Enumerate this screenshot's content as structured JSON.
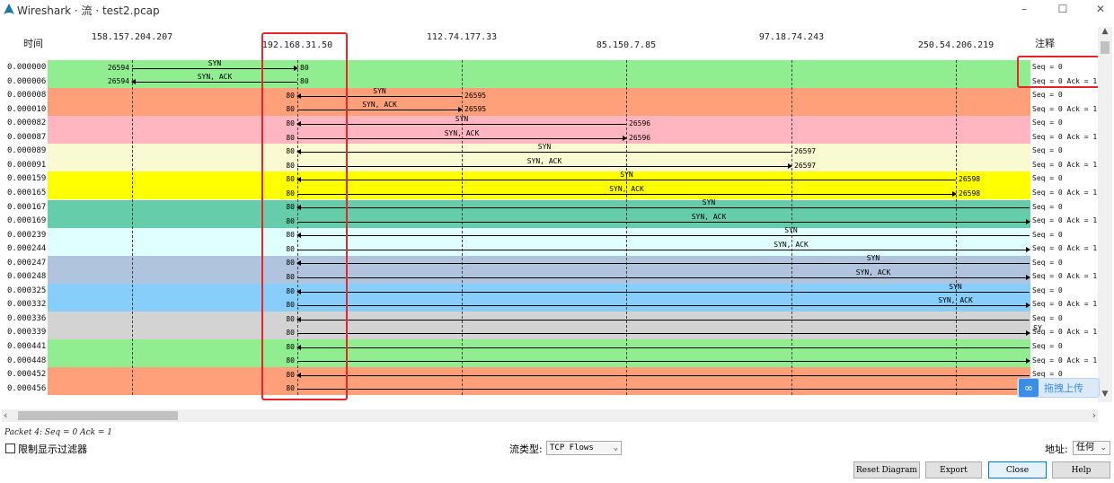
{
  "window": {
    "title": "Wireshark · 流 · test2.pcap",
    "minimize": "–",
    "maximize": "☐",
    "close": "✕"
  },
  "diagram": {
    "time_header": "时间",
    "note_header": "注释",
    "hosts": [
      "158.157.204.207",
      "192.168.31.50",
      "112.74.177.33",
      "85.150.7.85",
      "97.18.74.243",
      "250.54.206.219"
    ],
    "rows": [
      {
        "time": "0.000000",
        "note": "Seq = 0"
      },
      {
        "time": "0.000006",
        "note": "Seq = 0 Ack = 1"
      },
      {
        "time": "0.000008",
        "note": "Seq = 0"
      },
      {
        "time": "0.000010",
        "note": "Seq = 0 Ack = 1"
      },
      {
        "time": "0.000082",
        "note": "Seq = 0"
      },
      {
        "time": "0.000087",
        "note": "Seq = 0 Ack = 1"
      },
      {
        "time": "0.000089",
        "note": "Seq = 0"
      },
      {
        "time": "0.000091",
        "note": "Seq = 0 Ack = 1"
      },
      {
        "time": "0.000159",
        "note": "Seq = 0"
      },
      {
        "time": "0.000165",
        "note": "Seq = 0 Ack = 1"
      },
      {
        "time": "0.000167",
        "note": "Seq = 0"
      },
      {
        "time": "0.000169",
        "note": "Seq = 0 Ack = 1"
      },
      {
        "time": "0.000239",
        "note": "Seq = 0"
      },
      {
        "time": "0.000244",
        "note": "Seq = 0 Ack = 1"
      },
      {
        "time": "0.000247",
        "note": "Seq = 0"
      },
      {
        "time": "0.000248",
        "note": "Seq = 0 Ack = 1"
      },
      {
        "time": "0.000325",
        "note": "Seq = 0"
      },
      {
        "time": "0.000332",
        "note": "Seq = 0 Ack = 1"
      },
      {
        "time": "0.000336",
        "note": "Seq = 0"
      },
      {
        "time": "0.000339",
        "note": "Seq = 0 Ack = 1"
      },
      {
        "time": "0.000441",
        "note": "Seq = 0"
      },
      {
        "time": "0.000448",
        "note": "Seq = 0 Ack = 1"
      },
      {
        "time": "0.000452",
        "note": "Seq = 0"
      },
      {
        "time": "0.000456",
        "note": ""
      }
    ],
    "flows": [
      {
        "color": "#90ee90",
        "label_a": "SYN",
        "label_b": "SYN, ACK",
        "port_left": "26594",
        "port_server": "80",
        "peer_host_index": 0
      },
      {
        "color": "#ffa07a",
        "label_a": "SYN",
        "label_b": "SYN, ACK",
        "port_server": "80",
        "port_peer": "26595",
        "peer_host_index": 2
      },
      {
        "color": "#ffb6c1",
        "label_a": "SYN",
        "label_b": "SYN, ACK",
        "port_server": "80",
        "port_peer": "26596",
        "peer_host_index": 3
      },
      {
        "color": "#fafad2",
        "label_a": "SYN",
        "label_b": "SYN, ACK",
        "port_server": "80",
        "port_peer": "26597",
        "peer_host_index": 4
      },
      {
        "color": "#ffff00",
        "label_a": "SYN",
        "label_b": "SYN, ACK",
        "port_server": "80",
        "port_peer": "26598",
        "peer_host_index": 5
      },
      {
        "color": "#66cdaa",
        "label_a": "SYN",
        "label_b": "SYN, ACK",
        "port_server": "80",
        "peer_host_index": 6
      },
      {
        "color": "#e0ffff",
        "label_a": "SYN",
        "label_b": "SYN, ACK",
        "port_server": "80",
        "peer_host_index": 7
      },
      {
        "color": "#b0c4de",
        "label_a": "SYN",
        "label_b": "SYN, ACK",
        "port_server": "80",
        "peer_host_index": 8
      },
      {
        "color": "#87cefa",
        "label_a": "SYN",
        "label_b": "SYN, ACK",
        "port_server": "80",
        "peer_host_index": 9
      },
      {
        "color": "#d3d3d3",
        "label_a": "",
        "label_b": "SY",
        "port_server": "80",
        "peer_host_index": 10
      },
      {
        "color": "#90ee90",
        "label_a": "",
        "label_b": "",
        "port_server": "80",
        "peer_host_index": 11
      },
      {
        "color": "#ffa07a",
        "label_a": "",
        "label_b": "",
        "port_server": "80",
        "peer_host_index": 12
      }
    ]
  },
  "scroll": {
    "up": "▲",
    "down": "▼",
    "left": "‹",
    "right": "›"
  },
  "status": {
    "text": "Packet 4: Seq = 0 Ack = 1"
  },
  "upload_badge": {
    "icon": "∞",
    "label": "拖拽上传"
  },
  "controls": {
    "limit_filter_label": "限制显示过滤器",
    "flow_type_label": "流类型:",
    "flow_type_value": "TCP Flows",
    "address_label": "地址:",
    "address_value": "任何",
    "dropdown_chevron": "⌄"
  },
  "buttons": {
    "reset": "Reset Diagram",
    "export": "Export",
    "close": "Close",
    "help": "Help"
  }
}
